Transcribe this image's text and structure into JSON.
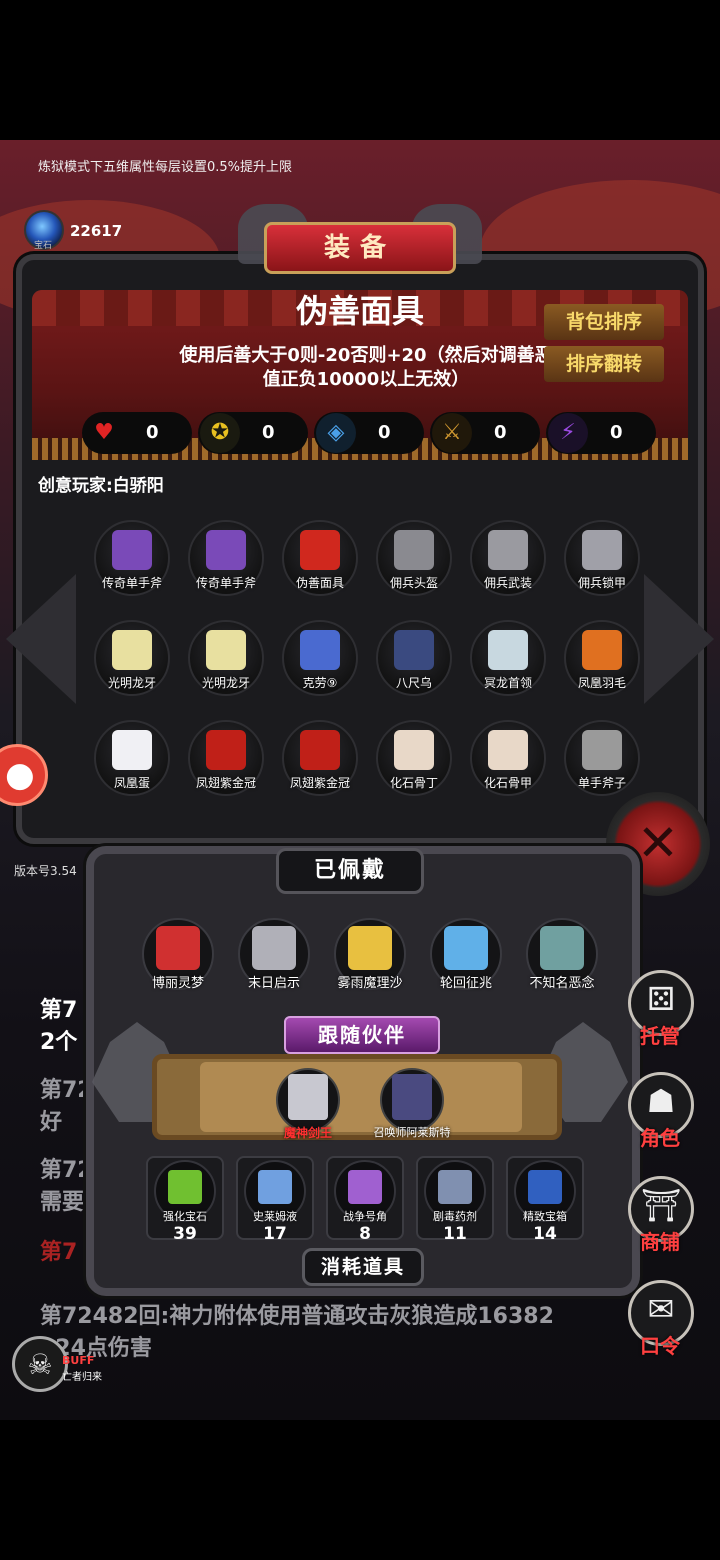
{
  "notice": "炼狱模式下五维属性每层设置0.5%提升上限",
  "gems": {
    "count": "22617",
    "label": "宝石"
  },
  "equip": {
    "title": "装备",
    "item_name": "伪善面具",
    "item_desc": "使用后善大于0则-20否则+20（然后对调善恶值正负10000以上无效）",
    "sort_button": "背包排序",
    "reverse_button": "排序翻转",
    "stats": [
      {
        "icon": "heart-icon",
        "value": "0"
      },
      {
        "icon": "strength-icon",
        "value": "0"
      },
      {
        "icon": "defense-icon",
        "value": "0"
      },
      {
        "icon": "sword-icon",
        "value": "0"
      },
      {
        "icon": "lightning-icon",
        "value": "0"
      }
    ],
    "creator": "创意玩家:白骄阳",
    "items": [
      {
        "label": "传奇单手斧",
        "color": "#7a4ab8"
      },
      {
        "label": "传奇单手斧",
        "color": "#7a4ab8"
      },
      {
        "label": "伪善面具",
        "color": "#d0281e"
      },
      {
        "label": "佣兵头盔",
        "color": "#8a8a90"
      },
      {
        "label": "佣兵武装",
        "color": "#9a9aa0"
      },
      {
        "label": "佣兵锁甲",
        "color": "#a0a0a8"
      },
      {
        "label": "光明龙牙",
        "color": "#e8e0a0"
      },
      {
        "label": "光明龙牙",
        "color": "#e8e0a0"
      },
      {
        "label": "克劳⑨",
        "color": "#4a6ad0"
      },
      {
        "label": "八尺乌",
        "color": "#3a4a80"
      },
      {
        "label": "冥龙首领",
        "color": "#c8d8e0"
      },
      {
        "label": "凤凰羽毛",
        "color": "#e07020"
      },
      {
        "label": "凤凰蛋",
        "color": "#f0f0f4"
      },
      {
        "label": "凤翅紫金冠",
        "color": "#c02018"
      },
      {
        "label": "凤翅紫金冠",
        "color": "#c02018"
      },
      {
        "label": "化石骨丁",
        "color": "#e8d8c8"
      },
      {
        "label": "化石骨甲",
        "color": "#e8d8c8"
      },
      {
        "label": "单手斧子",
        "color": "#9a9a9a"
      }
    ]
  },
  "version": "版本号3.54",
  "log": {
    "l1": "第7",
    "l2": "2个",
    "l3": "第72",
    "l3b": "好",
    "l4": "第72",
    "l4b": "需要",
    "l5": "第7",
    "l6": "第72482回:神力附体使用普通攻击灰狼造成16382",
    "l6b": "124点伤害"
  },
  "worn": {
    "title": "已佩戴",
    "items": [
      {
        "label": "博丽灵梦",
        "color": "#d03030"
      },
      {
        "label": "末日启示",
        "color": "#b0b0b8"
      },
      {
        "label": "雾雨魔理沙",
        "color": "#e8c040"
      },
      {
        "label": "轮回征兆",
        "color": "#60b0e8"
      },
      {
        "label": "不知名恶念",
        "color": "#70a0a0"
      }
    ]
  },
  "companion": {
    "title": "跟随伙伴",
    "items": [
      {
        "label": "魔神剑王",
        "color": "#c8c8d0"
      },
      {
        "label": "召唤师阿莱斯特",
        "color": "#4a4a80"
      }
    ]
  },
  "consumables": {
    "title": "消耗道具",
    "items": [
      {
        "label": "强化宝石",
        "count": "39",
        "color": "#70c030"
      },
      {
        "label": "史莱姆液",
        "count": "17",
        "color": "#70a0e0"
      },
      {
        "label": "战争号角",
        "count": "8",
        "color": "#a060d0"
      },
      {
        "label": "剧毒药剂",
        "count": "11",
        "color": "#8090b0"
      },
      {
        "label": "精致宝箱",
        "count": "14",
        "color": "#3060c0"
      }
    ]
  },
  "side_menu": [
    {
      "label": "托管",
      "icon": "dice-icon"
    },
    {
      "label": "角色",
      "icon": "hood-icon"
    },
    {
      "label": "商铺",
      "icon": "shop-icon"
    },
    {
      "label": "口令",
      "icon": "book-icon"
    }
  ],
  "buff": {
    "label": "BUFF",
    "sub": "亡者归来"
  }
}
